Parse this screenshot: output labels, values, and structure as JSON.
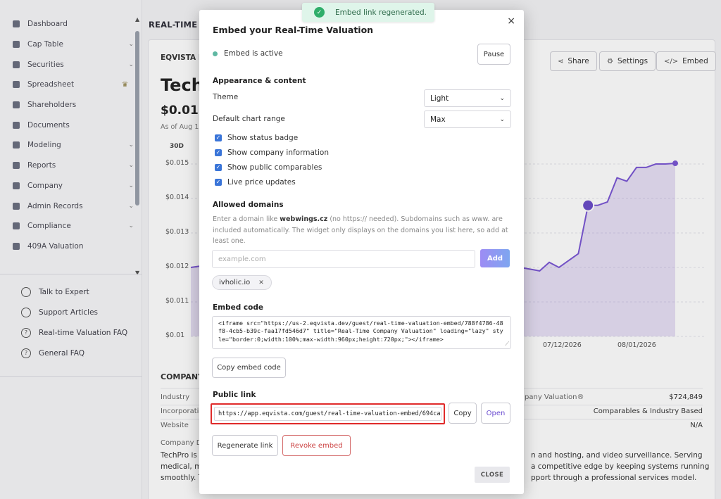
{
  "sidebar": {
    "items": [
      {
        "label": "Dashboard",
        "chevron": false,
        "crown": false
      },
      {
        "label": "Cap Table",
        "chevron": true,
        "crown": false
      },
      {
        "label": "Securities",
        "chevron": true,
        "crown": false
      },
      {
        "label": "Spreadsheet",
        "chevron": false,
        "crown": true
      },
      {
        "label": "Shareholders",
        "chevron": false,
        "crown": false
      },
      {
        "label": "Documents",
        "chevron": false,
        "crown": false
      },
      {
        "label": "Modeling",
        "chevron": true,
        "crown": false
      },
      {
        "label": "Reports",
        "chevron": true,
        "crown": false
      },
      {
        "label": "Company",
        "chevron": true,
        "crown": false
      },
      {
        "label": "Admin Records",
        "chevron": true,
        "crown": false
      },
      {
        "label": "Compliance",
        "chevron": true,
        "crown": false
      },
      {
        "label": "409A Valuation",
        "chevron": false,
        "crown": false
      }
    ],
    "help": [
      {
        "label": "Talk to Expert"
      },
      {
        "label": "Support Articles"
      },
      {
        "label": "Real-time Valuation FAQ"
      },
      {
        "label": "General FAQ"
      }
    ]
  },
  "page": {
    "breadcrumb": "REAL-TIME C",
    "card_title": "EQVISTA F",
    "company_name": "Tech",
    "price": "$0.01",
    "as_of": "As of Aug 12",
    "range_label": "30D",
    "buttons": {
      "share": "Share",
      "settings": "Settings",
      "embed": "Embed"
    },
    "company_heading": "COMPANY",
    "info_labels": [
      "Industry",
      "Incorporatio",
      "Website",
      "Company D"
    ],
    "info_right": [
      {
        "label": "pany Valuation®",
        "value": "$724,849"
      },
      {
        "label": "",
        "value": "Comparables & Industry Based"
      },
      {
        "label": "",
        "value": "N/A"
      }
    ],
    "desc_left": [
      "TechPro is a",
      "medical, m",
      "smoothly. T"
    ],
    "desc_right": [
      "n and hosting, and video surveillance. Serving",
      "a competitive edge by keeping systems running",
      "pport through a professional services model."
    ]
  },
  "chart_data": {
    "type": "line",
    "x_tick_labels": [
      "07/12/2026",
      "08/01/2026"
    ],
    "y_tick_labels": [
      "$0.015",
      "$0.014",
      "$0.013",
      "$0.012",
      "$0.011",
      "$0.01"
    ],
    "ylim": [
      0.01,
      0.015
    ],
    "series": [
      {
        "x": [
          0,
          5,
          10,
          15,
          20,
          25,
          30,
          35,
          40,
          42,
          44,
          46,
          48,
          50,
          52,
          54,
          56,
          58,
          60,
          62,
          64,
          66,
          68,
          70,
          72,
          74,
          76,
          78,
          80,
          82,
          84,
          86,
          88,
          90,
          92,
          94,
          96,
          98,
          100
        ],
        "y": [
          0.012,
          0.0121,
          0.0119,
          0.0122,
          0.0121,
          0.012,
          0.0121,
          0.0122,
          0.0121,
          0.012,
          0.0122,
          0.0121,
          0.012,
          0.0121,
          0.012,
          0.0122,
          0.0121,
          0.0122,
          0.012,
          0.0121,
          0.0119,
          0.0121,
          0.012,
          0.01195,
          0.0119,
          0.01215,
          0.012,
          0.0122,
          0.0124,
          0.0138,
          0.0138,
          0.0139,
          0.0146,
          0.0145,
          0.0149,
          0.0149,
          0.015,
          0.015,
          0.01502
        ]
      }
    ]
  },
  "modal": {
    "title": "Embed your Real-Time Valuation",
    "close_icon": "×",
    "status": "Embed is active",
    "status_color": "#5fb8a3",
    "pause": "Pause",
    "appearance_heading": "Appearance & content",
    "theme_label": "Theme",
    "theme_value": "Light",
    "range_label": "Default chart range",
    "range_value": "Max",
    "checkboxes": [
      {
        "label": "Show status badge",
        "checked": true
      },
      {
        "label": "Show company information",
        "checked": true
      },
      {
        "label": "Show public comparables",
        "checked": true
      },
      {
        "label": "Live price updates",
        "checked": true
      }
    ],
    "domains_heading": "Allowed domains",
    "domains_help_pre": "Enter a domain like ",
    "domains_help_bold": "webwings.cz",
    "domains_help_post": " (no https:// needed). Subdomains such as www. are included automatically. The widget only displays on the domains you list here, so add at least one.",
    "domain_placeholder": "example.com",
    "add": "Add",
    "domain_chip": "ivholic.io",
    "embed_heading": "Embed code",
    "embed_code": "<iframe src=\"https://us-2.eqvista.dev/guest/real-time-valuation-embed/788f4786-48f8-4cb5-b39c-faa17fd546d7\" title=\"Real-Time Company Valuation\" loading=\"lazy\" style=\"border:0;width:100%;max-width:960px;height:720px;\"></iframe>",
    "copy_embed": "Copy embed code",
    "public_heading": "Public link",
    "public_link": "https://app.eqvista.com/guest/real-time-valuation-embed/694ca",
    "copy": "Copy",
    "open": "Open",
    "regenerate": "Regenerate link",
    "revoke": "Revoke embed",
    "close": "CLOSE"
  },
  "toast": {
    "text": "Embed link regenerated.",
    "color": "#dff5ea"
  }
}
